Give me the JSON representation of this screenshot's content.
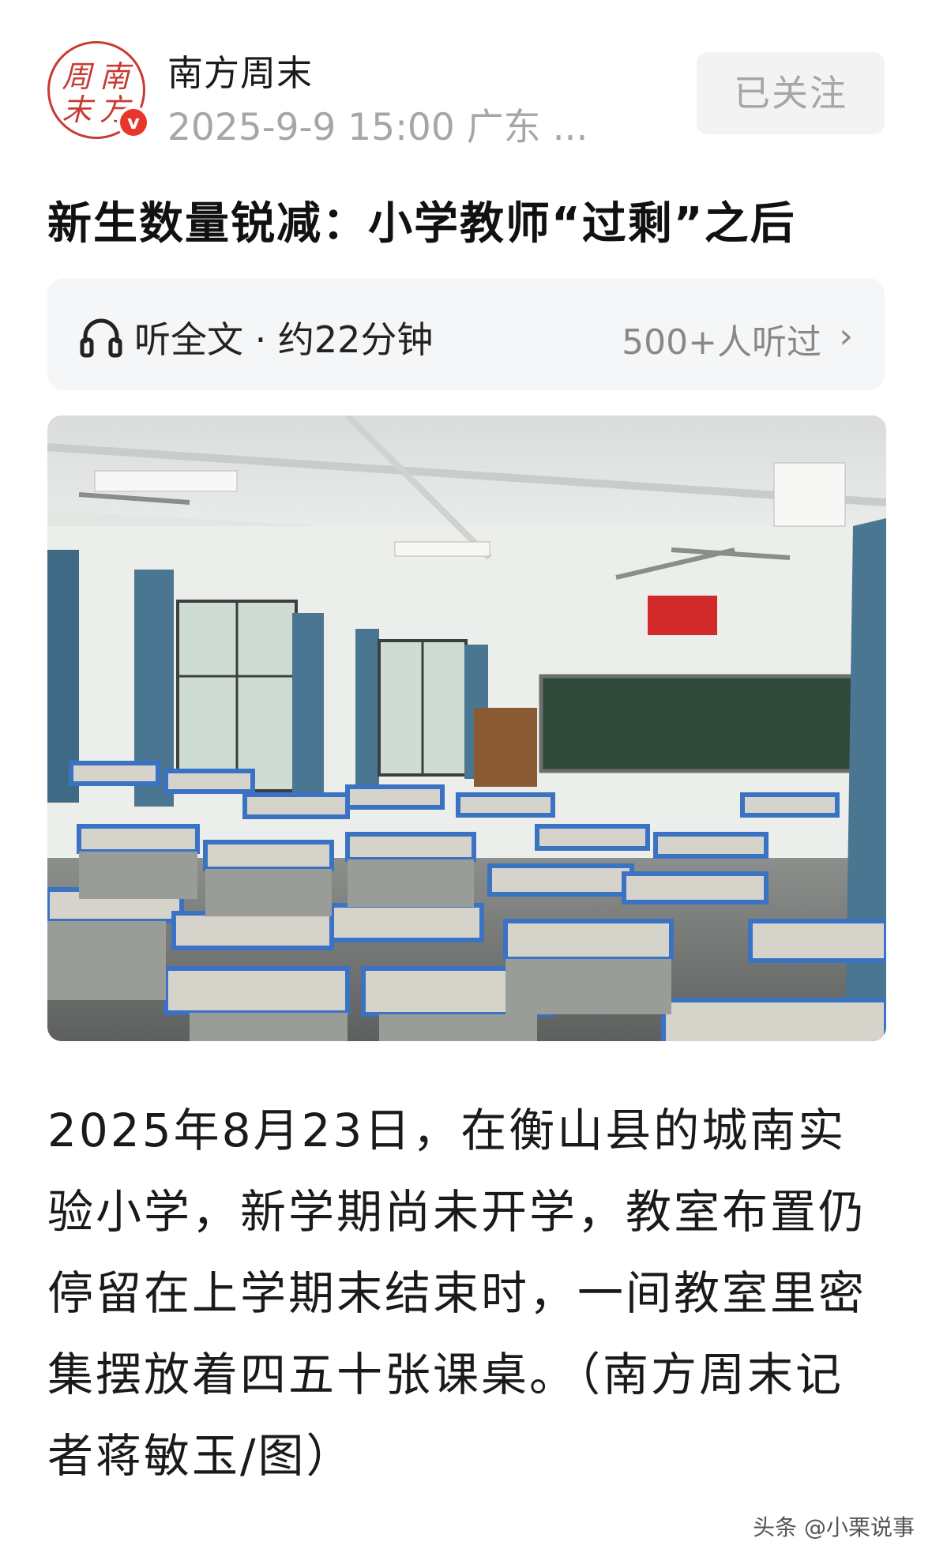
{
  "author": {
    "name": "南方周末",
    "date": "2025-9-9 15:00 广东 ...",
    "avatar_text": "南方周末",
    "verified_mark": "v"
  },
  "follow_button": {
    "label": "已关注"
  },
  "article": {
    "title": "新生数量锐减：小学教师“过剩”之后",
    "body": "2025年8月23日，在衡山县的城南实验小学，新学期尚未开学，教室布置仍停留在上学期末结束时，一间教室里密集摆放着四五十张课桌。（南方周末记者蒋敏玉/图）"
  },
  "listen": {
    "label": "听全文 · 约22分钟",
    "count": "500+人听过",
    "icon": "headphone-icon",
    "chevron": "›"
  },
  "photo": {
    "subject": "classroom-photo"
  },
  "watermark": "头条 @小栗说事",
  "colors": {
    "brand_red": "#c83a33",
    "verified_red": "#e8362c",
    "muted_gray": "#a6a6a6",
    "listen_bg": "#f5f6f7"
  }
}
